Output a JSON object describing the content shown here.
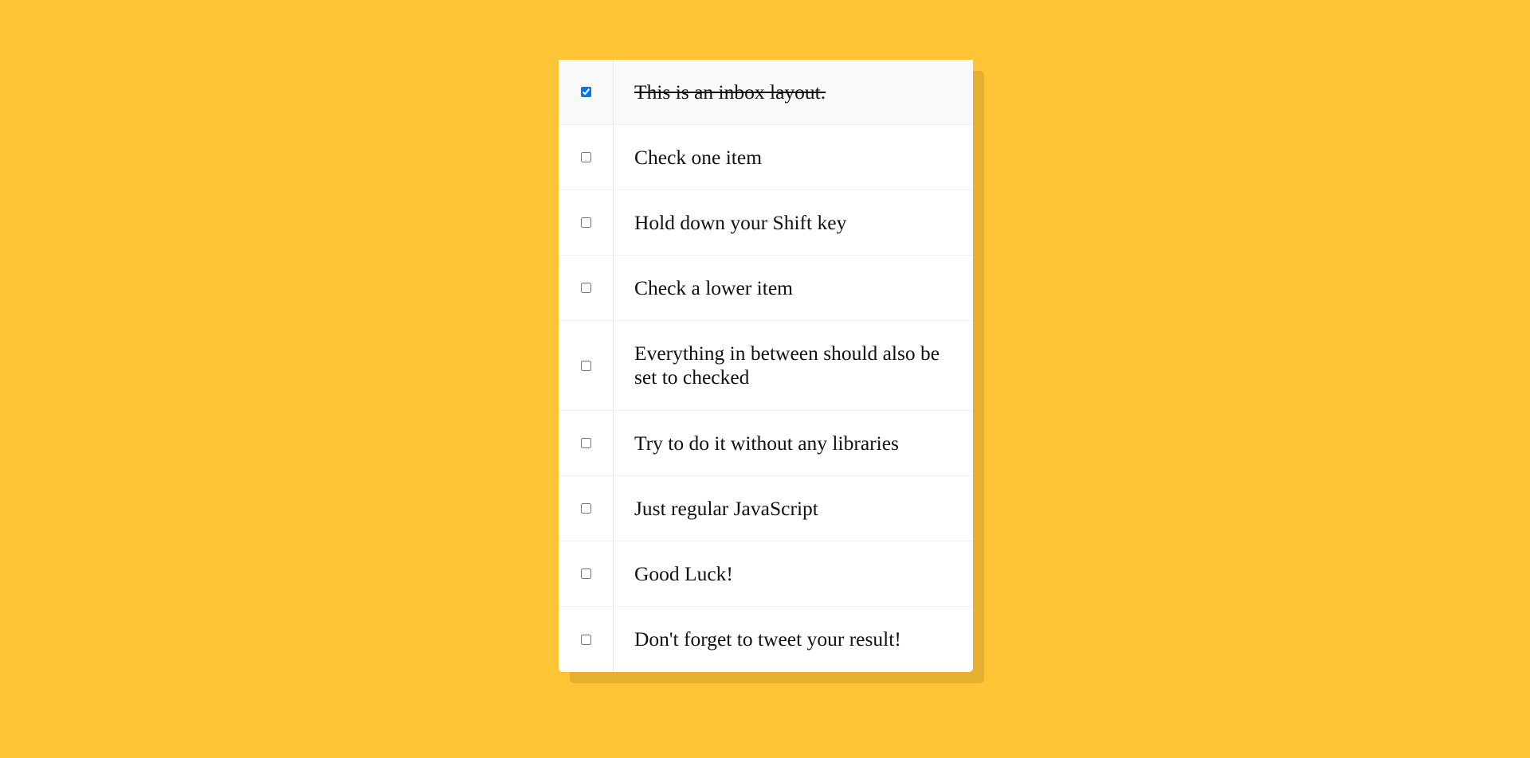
{
  "page": {
    "background_color": "#FFC435",
    "card_color": "#FFFFFF"
  },
  "inbox": {
    "items": [
      {
        "label": "This is an inbox layout.",
        "checked": true
      },
      {
        "label": "Check one item",
        "checked": false
      },
      {
        "label": "Hold down your Shift key",
        "checked": false
      },
      {
        "label": "Check a lower item",
        "checked": false
      },
      {
        "label": "Everything in between should also be set to checked",
        "checked": false
      },
      {
        "label": "Try to do it without any libraries",
        "checked": false
      },
      {
        "label": "Just regular JavaScript",
        "checked": false
      },
      {
        "label": "Good Luck!",
        "checked": false
      },
      {
        "label": "Don't forget to tweet your result!",
        "checked": false
      }
    ]
  }
}
